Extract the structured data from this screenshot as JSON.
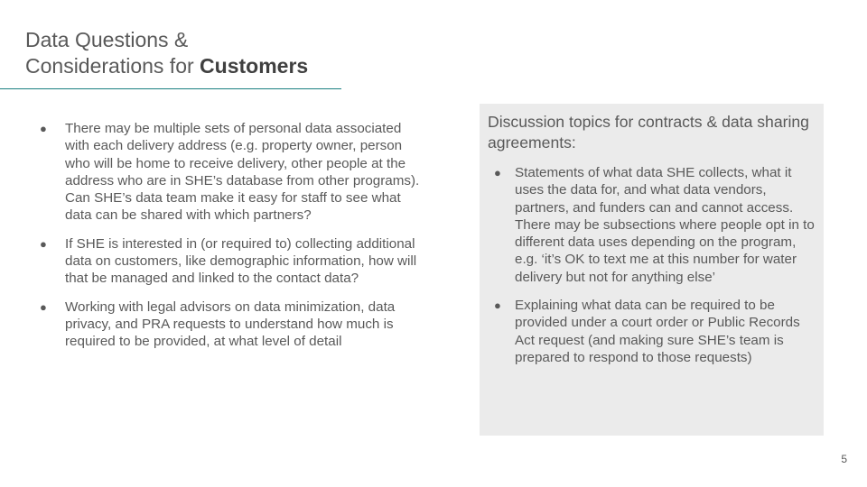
{
  "slide": {
    "title_line1": "Data Questions &",
    "title_line2_prefix": "Considerations for ",
    "title_line2_bold": "Customers",
    "accent_color": "#1a7f80",
    "page_number": "5"
  },
  "left_bullets": [
    "There may be multiple sets of personal data associated with each delivery address (e.g. property owner, person who will be home to receive delivery, other people at the address who are in SHE’s database from other programs). Can SHE’s data team make it easy for staff to see what data can be shared with which partners?",
    "If SHE is interested in (or required to) collecting additional data on customers, like demographic information, how will that be managed and linked to the contact data?",
    "Working with legal advisors on data minimization, data privacy, and PRA requests to understand how much is required to be provided, at what level of detail"
  ],
  "panel": {
    "title": "Discussion topics for contracts & data sharing agreements:",
    "background": "#ebebeb",
    "bullets": [
      "Statements of what data SHE collects, what it uses the data for, and what data vendors, partners, and funders can and cannot access. There may be subsections where people opt in to different data uses depending on the program, e.g. ‘it’s OK to text me at this number for water delivery but not for anything else’",
      "Explaining what data can be required to be provided under a court order or Public Records Act request (and making sure SHE’s team is prepared to respond to those requests)"
    ]
  }
}
